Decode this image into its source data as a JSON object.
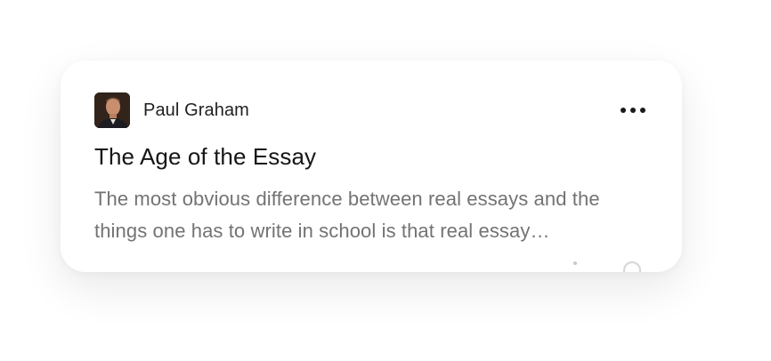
{
  "card": {
    "author": "Paul Graham",
    "title": "The Age of the Essay",
    "excerpt": "The most obvious difference between real essays and the things one has to write in school is that real essay…"
  },
  "icons": {
    "avatar": "author-photo",
    "more": "more-horizontal-icon"
  }
}
